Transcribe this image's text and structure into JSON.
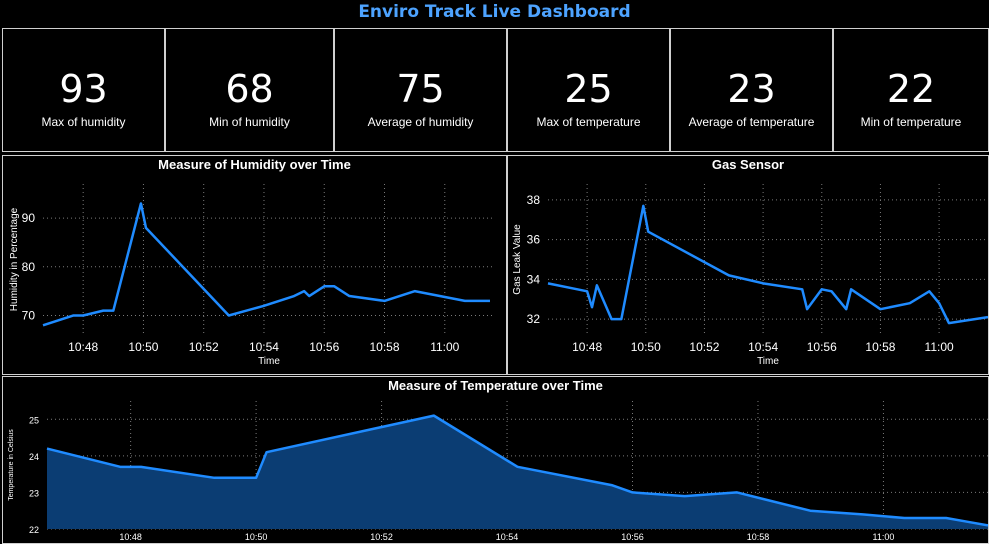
{
  "title": "Enviro Track Live Dashboard",
  "kpis": [
    {
      "value": "93",
      "label": "Max of humidity"
    },
    {
      "value": "68",
      "label": "Min of humidity"
    },
    {
      "value": "75",
      "label": "Average of humidity"
    },
    {
      "value": "25",
      "label": "Max of temperature"
    },
    {
      "value": "23",
      "label": "Average of temperature"
    },
    {
      "value": "22",
      "label": "Min of temperature"
    }
  ],
  "colors": {
    "line": "#1f8bff",
    "area": "#0b3d73",
    "title": "#4da3ff",
    "grid": "#7a7a7a"
  },
  "chart_data": [
    {
      "type": "line",
      "title": "Measure of Humidity over Time",
      "xlabel": "Time",
      "ylabel": "Humidity in Percentage",
      "xticks": [
        "10:48",
        "10:50",
        "10:52",
        "10:54",
        "10:56",
        "10:58",
        "11:00"
      ],
      "yticks": [
        70,
        80,
        90
      ],
      "xlim": [
        "10:46:40",
        "11:01:40"
      ],
      "ylim": [
        66,
        97
      ],
      "grid": true,
      "series": [
        {
          "points": [
            [
              "10:46:40",
              68
            ],
            [
              "10:47:40",
              70
            ],
            [
              "10:48:00",
              70
            ],
            [
              "10:48:40",
              71
            ],
            [
              "10:49:00",
              71
            ],
            [
              "10:49:55",
              93
            ],
            [
              "10:50:05",
              88
            ],
            [
              "10:52:50",
              70
            ],
            [
              "10:54:00",
              72
            ],
            [
              "10:55:00",
              74
            ],
            [
              "10:55:20",
              75
            ],
            [
              "10:55:30",
              74
            ],
            [
              "10:56:00",
              76
            ],
            [
              "10:56:20",
              76
            ],
            [
              "10:56:50",
              74
            ],
            [
              "10:58:00",
              73
            ],
            [
              "10:59:00",
              75
            ],
            [
              "11:00:40",
              73
            ],
            [
              "11:01:30",
              73
            ]
          ]
        }
      ]
    },
    {
      "type": "line",
      "title": "Gas Sensor",
      "xlabel": "Time",
      "ylabel": "Gas Leak Value",
      "xticks": [
        "10:48",
        "10:50",
        "10:52",
        "10:54",
        "10:56",
        "10:58",
        "11:00"
      ],
      "yticks": [
        32,
        34,
        36,
        38
      ],
      "xlim": [
        "10:46:40",
        "11:01:40"
      ],
      "ylim": [
        31.2,
        38.8
      ],
      "grid": true,
      "series": [
        {
          "points": [
            [
              "10:46:40",
              33.8
            ],
            [
              "10:47:40",
              33.5
            ],
            [
              "10:48:00",
              33.4
            ],
            [
              "10:48:10",
              32.6
            ],
            [
              "10:48:20",
              33.7
            ],
            [
              "10:48:50",
              32.0
            ],
            [
              "10:49:10",
              32.0
            ],
            [
              "10:49:55",
              37.7
            ],
            [
              "10:50:05",
              36.4
            ],
            [
              "10:52:50",
              34.2
            ],
            [
              "10:54:00",
              33.8
            ],
            [
              "10:55:20",
              33.5
            ],
            [
              "10:55:30",
              32.5
            ],
            [
              "10:56:00",
              33.5
            ],
            [
              "10:56:20",
              33.4
            ],
            [
              "10:56:50",
              32.5
            ],
            [
              "10:57:00",
              33.5
            ],
            [
              "10:58:00",
              32.5
            ],
            [
              "10:59:00",
              32.8
            ],
            [
              "10:59:40",
              33.4
            ],
            [
              "11:00:00",
              32.8
            ],
            [
              "11:00:20",
              31.8
            ],
            [
              "11:01:40",
              32.1
            ]
          ]
        }
      ]
    },
    {
      "type": "area",
      "title": "Measure of Temperature over Time",
      "xlabel": "",
      "ylabel": "Temperature in Celsius",
      "xticks": [
        "10:48",
        "10:50",
        "10:52",
        "10:54",
        "10:56",
        "10:58",
        "11:00"
      ],
      "yticks": [
        22,
        23,
        24,
        25
      ],
      "xlim": [
        "10:46:40",
        "11:01:40"
      ],
      "ylim": [
        22,
        25.5
      ],
      "grid": true,
      "series": [
        {
          "points": [
            [
              "10:46:40",
              24.2
            ],
            [
              "10:47:50",
              23.7
            ],
            [
              "10:48:10",
              23.7
            ],
            [
              "10:49:20",
              23.4
            ],
            [
              "10:50:00",
              23.4
            ],
            [
              "10:50:10",
              24.1
            ],
            [
              "10:52:50",
              25.1
            ],
            [
              "10:54:10",
              23.7
            ],
            [
              "10:55:40",
              23.2
            ],
            [
              "10:56:00",
              23.0
            ],
            [
              "10:56:50",
              22.9
            ],
            [
              "10:57:40",
              23.0
            ],
            [
              "10:58:50",
              22.5
            ],
            [
              "10:59:40",
              22.4
            ],
            [
              "11:00:20",
              22.3
            ],
            [
              "11:01:00",
              22.3
            ],
            [
              "11:01:20",
              22.2
            ],
            [
              "11:01:40",
              22.1
            ]
          ]
        }
      ]
    }
  ]
}
